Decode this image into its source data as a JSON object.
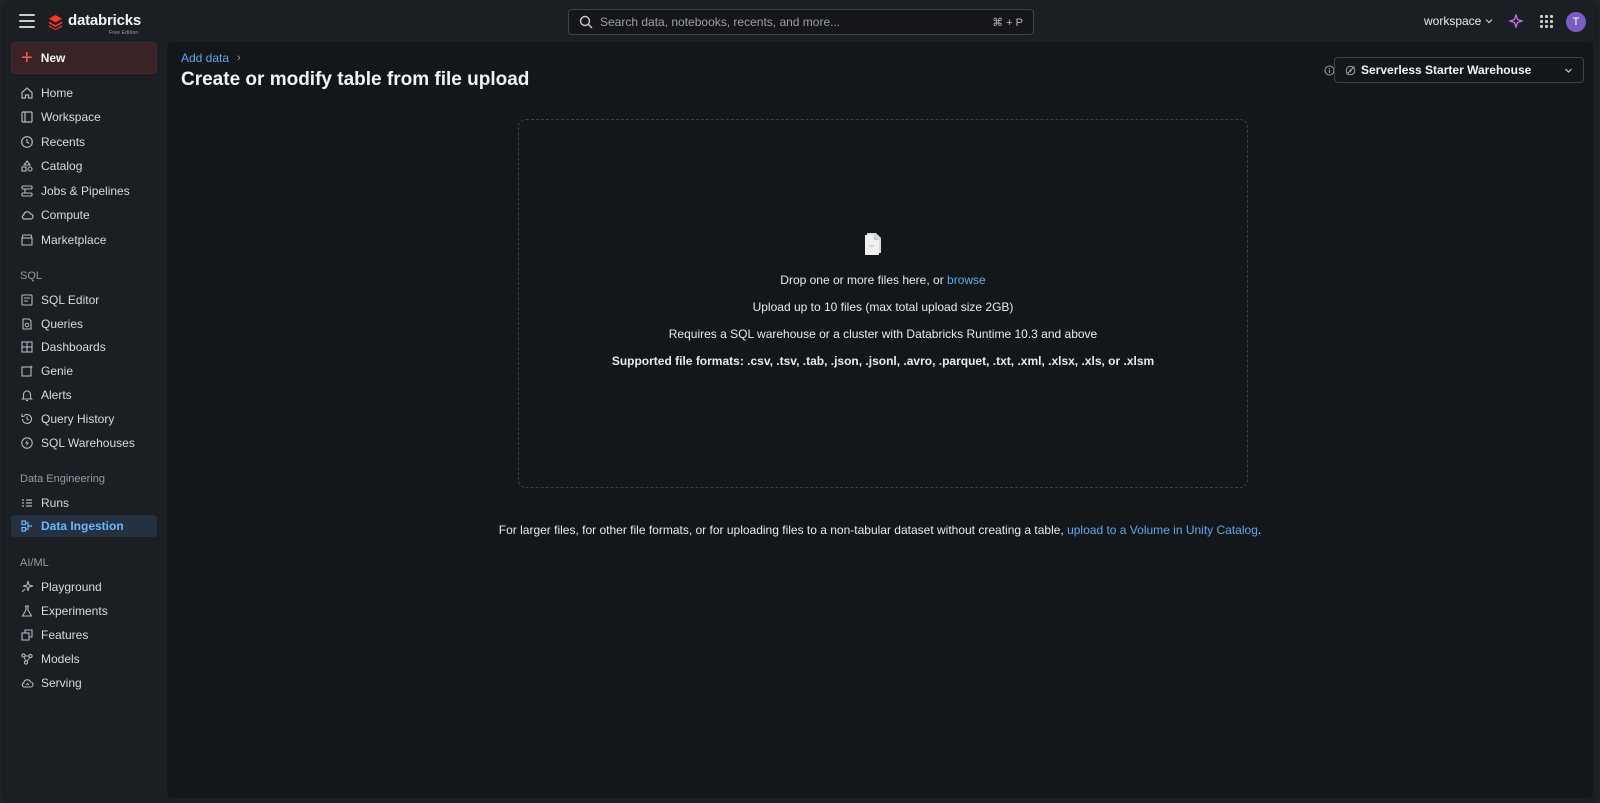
{
  "header": {
    "brand": "databricks",
    "brand_sub": "Free Edition",
    "search_placeholder": "Search data, notebooks, recents, and more...",
    "search_shortcut": "⌘ + P",
    "workspace_label": "workspace",
    "avatar_initial": "T"
  },
  "sidebar": {
    "new_label": "New",
    "top_items": [
      {
        "label": "Home"
      },
      {
        "label": "Workspace"
      },
      {
        "label": "Recents"
      },
      {
        "label": "Catalog"
      },
      {
        "label": "Jobs & Pipelines"
      },
      {
        "label": "Compute"
      },
      {
        "label": "Marketplace"
      }
    ],
    "sql_section": "SQL",
    "sql_items": [
      {
        "label": "SQL Editor"
      },
      {
        "label": "Queries"
      },
      {
        "label": "Dashboards"
      },
      {
        "label": "Genie"
      },
      {
        "label": "Alerts"
      },
      {
        "label": "Query History"
      },
      {
        "label": "SQL Warehouses"
      }
    ],
    "de_section": "Data Engineering",
    "de_items": [
      {
        "label": "Runs"
      },
      {
        "label": "Data Ingestion",
        "active": true
      }
    ],
    "ml_section": "AI/ML",
    "ml_items": [
      {
        "label": "Playground"
      },
      {
        "label": "Experiments"
      },
      {
        "label": "Features"
      },
      {
        "label": "Models"
      },
      {
        "label": "Serving"
      }
    ]
  },
  "main": {
    "breadcrumb": "Add data",
    "breadcrumb_sep": "›",
    "title": "Create or modify table from file upload",
    "warehouse_label": "Serverless Starter Warehouse",
    "dropzone": {
      "drop_text": "Drop one or more files here, or ",
      "browse_link": "browse",
      "limit_text": "Upload up to 10 files (max total upload size 2GB)",
      "requires_text": "Requires a SQL warehouse or a cluster with Databricks Runtime 10.3 and above",
      "formats_text": "Supported file formats: .csv, .tsv, .tab, .json, .jsonl, .avro, .parquet, .txt, .xml, .xlsx, .xls, or .xlsm"
    },
    "footer_text": "For larger files, for other file formats, or for uploading files to a non-tabular dataset without creating a table, ",
    "footer_link": "upload to a Volume in Unity Catalog",
    "footer_end": "."
  },
  "colors": {
    "accent_link": "#5aa8f0",
    "brand_red": "#ff3621",
    "active_bg": "#233140"
  }
}
